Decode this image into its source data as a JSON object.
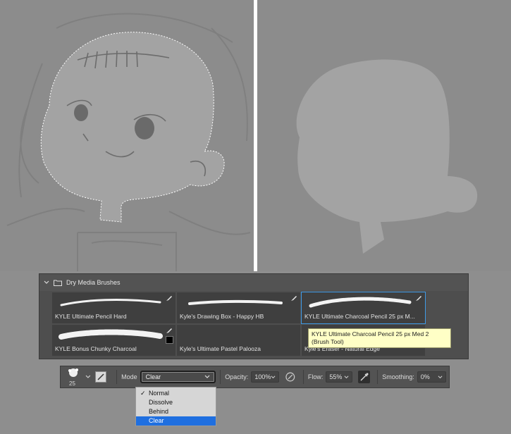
{
  "canvas": {
    "left_sketch": "Sketch with selection outline",
    "right_shape": "Filled silhouette"
  },
  "brush_panel": {
    "group_name": "Dry Media Brushes",
    "brushes": [
      {
        "label": "KYLE Ultimate Pencil Hard"
      },
      {
        "label": "Kyle's Drawing Box - Happy HB"
      },
      {
        "label": "KYLE Ultimate Charcoal Pencil 25 px M..."
      },
      {
        "label": "KYLE Bonus Chunky Charcoal"
      },
      {
        "label": "Kyle's Ultimate Pastel Palooza"
      },
      {
        "label": "Kyle's Eraser - Natural Edge"
      }
    ],
    "tooltip_line1": "KYLE Ultimate Charcoal Pencil 25 px Med 2",
    "tooltip_line2": "(Brush Tool)"
  },
  "options_bar": {
    "brush_size": "25",
    "mode_label": "Mode",
    "mode_value": "Clear",
    "opacity_label": "Opacity:",
    "opacity_value": "100%",
    "flow_label": "Flow:",
    "flow_value": "55%",
    "smoothing_label": "Smoothing:",
    "smoothing_value": "0%"
  },
  "mode_dropdown": {
    "items": [
      "Normal",
      "Dissolve",
      "Behind",
      "Clear"
    ],
    "checked": "Normal",
    "highlighted": "Clear"
  },
  "colors": {
    "selection_highlight": "#1f6fe0",
    "tooltip_bg": "#ffffc6",
    "panel_bg": "#4e4e4e"
  }
}
